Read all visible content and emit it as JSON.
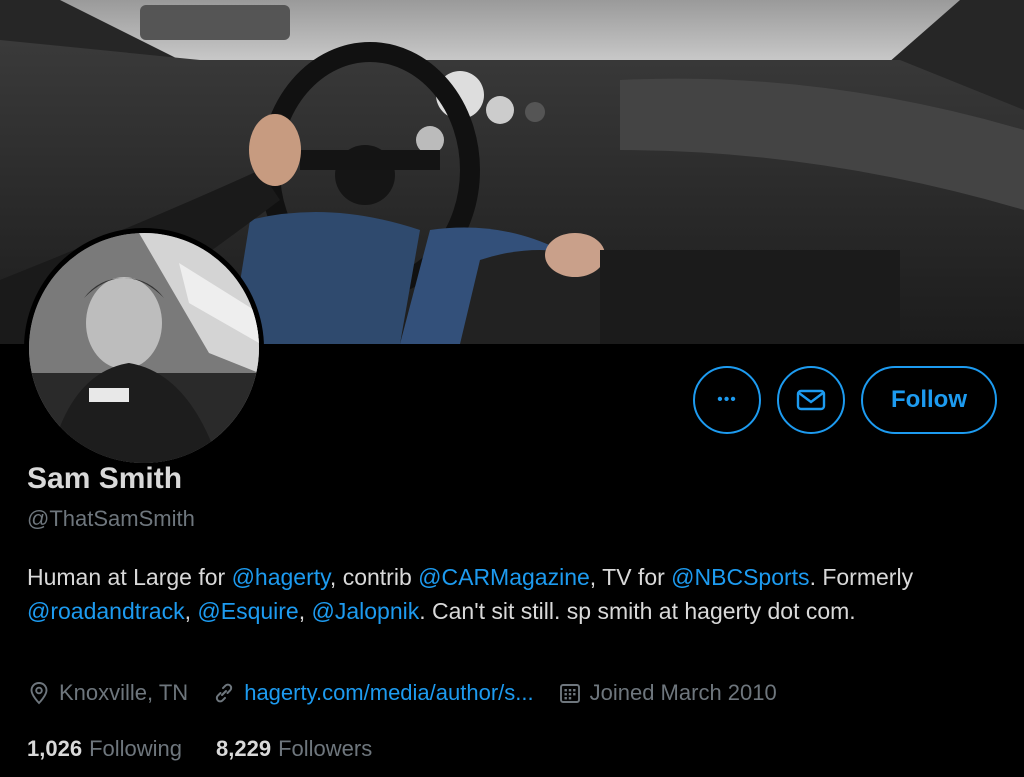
{
  "profile": {
    "name": "Sam Smith",
    "handle": "@ThatSamSmith",
    "bio": [
      {
        "text": "Human at Large for ",
        "link": false
      },
      {
        "text": "@hagerty",
        "link": true
      },
      {
        "text": ", contrib ",
        "link": false
      },
      {
        "text": "@CARMagazine",
        "link": true
      },
      {
        "text": ", TV for ",
        "link": false
      },
      {
        "text": "@NBCSports",
        "link": true
      },
      {
        "text": ". Formerly ",
        "link": false
      },
      {
        "text": "@roadandtrack",
        "link": true
      },
      {
        "text": ", ",
        "link": false
      },
      {
        "text": "@Esquire",
        "link": true
      },
      {
        "text": ", ",
        "link": false
      },
      {
        "text": "@Jalopnik",
        "link": true
      },
      {
        "text": ". Can't sit still. sp smith at hagerty dot com.",
        "link": false
      }
    ],
    "location": "Knoxville, TN",
    "website": "hagerty.com/media/author/s...",
    "joined": "Joined March 2010"
  },
  "actions": {
    "more_label": "•••",
    "follow_label": "Follow"
  },
  "stats": {
    "following_count": "1,026",
    "following_label": "Following",
    "followers_count": "8,229",
    "followers_label": "Followers"
  },
  "icons": {
    "more": "more-icon",
    "message": "mail-icon",
    "location": "location-pin-icon",
    "link": "link-icon",
    "calendar": "calendar-icon"
  },
  "colors": {
    "accent": "#1d9bf0",
    "background": "#000000",
    "text": "#d9d9d9",
    "muted": "#6e767d"
  }
}
